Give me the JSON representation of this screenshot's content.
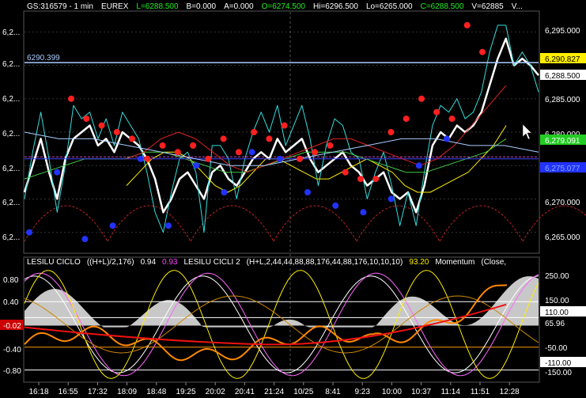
{
  "header": [
    {
      "text": "GS:316579 - 1 min",
      "color": "#ffffff"
    },
    {
      "text": "EUREX",
      "color": "#ffffff"
    },
    {
      "text": "L=6288.500",
      "color": "#22ee22"
    },
    {
      "text": "B=0.000",
      "color": "#ffffff"
    },
    {
      "text": "A=0.000",
      "color": "#ffffff"
    },
    {
      "text": "O=6274.500",
      "color": "#22ee22"
    },
    {
      "text": "Hi=6296.500",
      "color": "#ffffff"
    },
    {
      "text": "Lo=6265.000",
      "color": "#ffffff"
    },
    {
      "text": "C=6288.500",
      "color": "#22ee22"
    },
    {
      "text": "V=62885",
      "color": "#ffffff"
    },
    {
      "text": "V...",
      "color": "#ffffff"
    }
  ],
  "indicator_header": [
    {
      "text": "LESILU CICLO",
      "color": "#ffffff"
    },
    {
      "text": "((H+L)/2,176)",
      "color": "#ffffff"
    },
    {
      "text": "0.94",
      "color": "#ffffff"
    },
    {
      "text": "0.93",
      "color": "#ff44ff"
    },
    {
      "text": "LESILU CICLI 2",
      "color": "#ffffff"
    },
    {
      "text": "(H+L,2,44,44,88,88,176,44,88,176,10,10,10)",
      "color": "#ffffff"
    },
    {
      "text": "93.20",
      "color": "#ffee00"
    },
    {
      "text": "Momentum",
      "color": "#ffffff"
    },
    {
      "text": "(Close,",
      "color": "#ffffff"
    }
  ],
  "price_level_label": "6290.399",
  "left_axis_top": [
    "6,2...",
    "6,2...",
    "6,2...",
    "6,2...",
    "6,2...",
    "6,2...",
    "6,2..."
  ],
  "left_axis_bottom": [
    "0.80",
    "0.40",
    "-0.02",
    "-0.40",
    "-0.80"
  ],
  "right_axis_top": [
    "6,295.000",
    "6,290.827",
    "6,288.500",
    "6,285.000",
    "6,280.000",
    "6,279.091",
    "6,275.077",
    "6,270.000",
    "6,265.000"
  ],
  "right_axis_bottom": [
    "250.00",
    "150.00",
    "110.00",
    "65.96",
    "-50.00",
    "-110.00",
    "-150.00"
  ],
  "x_axis": [
    "16:18",
    "16:55",
    "17:32",
    "18:09",
    "18:48",
    "19:25",
    "20:02",
    "20:41",
    "21:24",
    "10/25",
    "8:41",
    "9:23",
    "10:00",
    "10:37",
    "11:14",
    "11:51",
    "12:28"
  ],
  "chart_data": {
    "type": "line",
    "panels": [
      {
        "name": "price",
        "y_ticks": [
          6265,
          6270,
          6275,
          6280,
          6285,
          6290,
          6295
        ],
        "ylim": [
          6262,
          6298
        ],
        "reference_level": 6290.399,
        "last_close": 6288.5,
        "series": [
          {
            "color": "#ffffff",
            "values": [
              6271,
              6275,
              6279,
              6274,
              6270,
              6276,
              6279,
              6280,
              6281,
              6278,
              6279,
              6277,
              6280,
              6279,
              6278,
              6276,
              6273,
              6268,
              6270,
              6273,
              6274,
              6272,
              6270,
              6274,
              6275,
              6273,
              6272,
              6274,
              6276,
              6277,
              6276,
              6279,
              6277,
              6278,
              6279,
              6276,
              6274,
              6275,
              6276,
              6277,
              6275,
              6274,
              6272,
              6273,
              6274,
              6271,
              6270,
              6271,
              6268,
              6272,
              6278,
              6280,
              6279,
              6281,
              6280,
              6281,
              6283,
              6287,
              6291,
              6294,
              6290,
              6291,
              6290,
              6288.5
            ]
          },
          {
            "color": "#33dddd",
            "values": [
              6270,
              6277,
              6283,
              6276,
              6268,
              6275,
              6284,
              6282,
              6283,
              6279,
              6282,
              6278,
              6283,
              6281,
              6279,
              6274,
              6268,
              6265,
              6271,
              6276,
              6277,
              6274,
              6265,
              6278,
              6278,
              6276,
              6270,
              6276,
              6280,
              6283,
              6280,
              6284,
              6278,
              6281,
              6284,
              6279,
              6272,
              6278,
              6282,
              6281,
              6277,
              6276,
              6270,
              6274,
              6277,
              6272,
              6266,
              6271,
              6266,
              6274,
              6281,
              6284,
              6283,
              6285,
              6282,
              6283,
              6286,
              6292,
              6296,
              6296,
              6290,
              6292,
              6290,
              6286
            ]
          },
          {
            "color": "#ffee00",
            "values": [
              6272,
              6274,
              6276,
              6277,
              6277,
              6276,
              6274,
              6272,
              6271,
              6272,
              6274,
              6276,
              6276,
              6275,
              6274,
              6273,
              6273,
              6274,
              6275,
              6276,
              6275,
              6274,
              6272,
              6271,
              6271,
              6272,
              6273,
              6274,
              6276,
              6278,
              6281
            ]
          },
          {
            "color": "#44cc44",
            "values": [
              6273,
              6274,
              6275,
              6276,
              6276,
              6276,
              6277,
              6277,
              6276,
              6275,
              6274,
              6274,
              6275,
              6276,
              6277,
              6277,
              6277,
              6276,
              6275,
              6274,
              6274,
              6275,
              6276,
              6277,
              6279
            ]
          },
          {
            "color": "#4444ff",
            "values": [
              6276,
              6276,
              6276,
              6276,
              6276,
              6276,
              6276,
              6276,
              6276,
              6276,
              6276,
              6276,
              6276,
              6276,
              6276
            ]
          },
          {
            "color": "#dd2222",
            "values": [
              6276,
              6277,
              6279,
              6280,
              6279,
              6277,
              6275,
              6274,
              6275,
              6276,
              6277,
              6278,
              6279,
              6279,
              6278,
              6277,
              6276,
              6275,
              6276,
              6278,
              6281,
              6284,
              6287
            ]
          },
          {
            "color": "#aaccff",
            "values": [
              6280,
              6279,
              6279,
              6278,
              6277,
              6276,
              6275,
              6275,
              6276,
              6277,
              6278,
              6279,
              6279,
              6278,
              6278,
              6277
            ]
          }
        ],
        "red_dots": [
          6285,
          6282,
          6281,
          6280,
          6279,
          6276,
          6278,
          6277,
          6278,
          6276,
          6279,
          6277,
          6280,
          6279,
          6281,
          6276,
          6277,
          6278,
          6274,
          6273,
          6273,
          6280,
          6282,
          6285,
          6283,
          6282,
          6296,
          6292
        ],
        "blue_dots": [
          6265,
          6274,
          6264,
          6266,
          6276,
          6266,
          6275,
          6271,
          6277,
          6276,
          6271,
          6269,
          6268,
          6270,
          6275,
          6279
        ]
      },
      {
        "name": "oscillators",
        "y_ticks": [
          -0.8,
          -0.4,
          0.4,
          0.8
        ],
        "ylim": [
          -1.0,
          1.0
        ],
        "current_values": {
          "cycle": 0.94,
          "signal": 0.93,
          "cycle2": 93.2,
          "momentum": 65.96,
          "level": 110.0
        }
      }
    ]
  }
}
